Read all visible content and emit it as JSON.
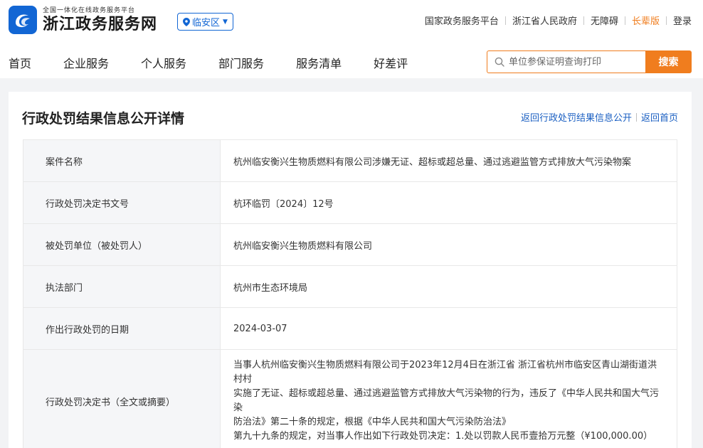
{
  "header": {
    "logo_subtitle": "全国一体化在线政务服务平台",
    "logo_title": "浙江政务服务网",
    "region": "临安区",
    "top_links": [
      "国家政务服务平台",
      "浙江省人民政府",
      "无障碍",
      "长辈版",
      "登录"
    ]
  },
  "nav": {
    "items": [
      "首页",
      "企业服务",
      "个人服务",
      "部门服务",
      "服务清单",
      "好差评"
    ]
  },
  "search": {
    "placeholder": "单位参保证明查询打印",
    "button_label": "搜索"
  },
  "panel": {
    "title": "行政处罚结果信息公开详情",
    "back_list_link": "返回行政处罚结果信息公开",
    "back_home_link": "返回首页"
  },
  "details": [
    {
      "label": "案件名称",
      "value": "杭州临安衡兴生物质燃料有限公司涉嫌无证、超标或超总量、通过逃避监管方式排放大气污染物案"
    },
    {
      "label": "行政处罚决定书文号",
      "value": "杭环临罚〔2024〕12号"
    },
    {
      "label": "被处罚单位（被处罚人）",
      "value": "杭州临安衡兴生物质燃料有限公司"
    },
    {
      "label": "执法部门",
      "value": "杭州市生态环境局"
    },
    {
      "label": "作出行政处罚的日期",
      "value": "2024-03-07"
    },
    {
      "label": "行政处罚决定书（全文或摘要）",
      "value_lines": [
        "当事人杭州临安衡兴生物质燃料有限公司于2023年12月4日在浙江省 浙江省杭州市临安区青山湖街道洪村村",
        "实施了无证、超标或超总量、通过逃避监管方式排放大气污染物的行为，违反了《中华人民共和国大气污染",
        "防治法》第二十条的规定，根据《中华人民共和国大气污染防治法》",
        "第九十九条的规定，对当事人作出如下行政处罚决定：1.处以罚款人民币壹拾万元整（¥100,000.00）"
      ]
    }
  ],
  "colors": {
    "brand_blue": "#1266d4",
    "accent_orange": "#f07d1e",
    "link_blue": "#1a5fc2",
    "page_bg": "#f2f3f5"
  }
}
